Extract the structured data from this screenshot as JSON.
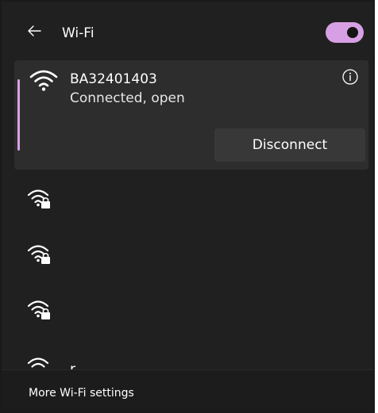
{
  "header": {
    "title": "Wi-Fi",
    "back_icon": "back-arrow-icon",
    "wifi_toggle_on": true,
    "accent_color": "#d8a0e4"
  },
  "connected_network": {
    "name": "BA32401403",
    "status": "Connected, open",
    "icon": "wifi-full-signal-icon",
    "info_icon": "info-icon",
    "disconnect_label": "Disconnect"
  },
  "networks": [
    {
      "icon": "wifi-secured-icon"
    },
    {
      "icon": "wifi-secured-icon"
    },
    {
      "icon": "wifi-secured-icon"
    },
    {
      "icon": "wifi-icon",
      "partial_text": "r."
    }
  ],
  "footer": {
    "more_settings_label": "More Wi-Fi settings"
  }
}
